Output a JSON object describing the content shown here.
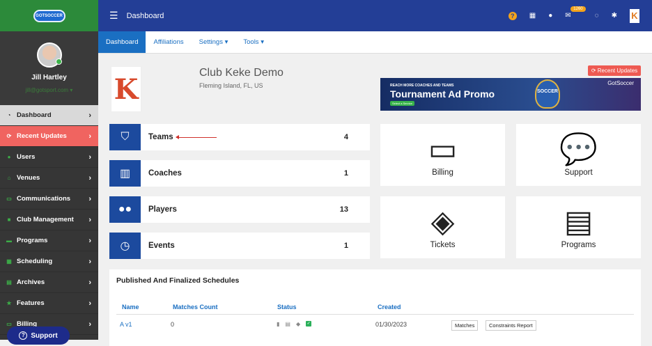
{
  "sidebar": {
    "logo_text": "GOTSOCCER",
    "user_name": "Jill Hartley",
    "user_email": "jill@gotsport.com",
    "items": [
      {
        "label": "Dashboard",
        "icon": "tachometer-icon"
      },
      {
        "label": "Recent Updates",
        "icon": "refresh-icon"
      },
      {
        "label": "Users",
        "icon": "users-icon"
      },
      {
        "label": "Venues",
        "icon": "home-icon"
      },
      {
        "label": "Communications",
        "icon": "chat-icon"
      },
      {
        "label": "Club Management",
        "icon": "briefcase-icon"
      },
      {
        "label": "Programs",
        "icon": "folder-icon"
      },
      {
        "label": "Scheduling",
        "icon": "calendar-icon"
      },
      {
        "label": "Archives",
        "icon": "archive-icon"
      },
      {
        "label": "Features",
        "icon": "star-icon"
      },
      {
        "label": "Billing",
        "icon": "credit-card-icon"
      }
    ],
    "support_label": "Support"
  },
  "topbar": {
    "title": "Dashboard",
    "mail_badge": "1260"
  },
  "tabs": [
    {
      "label": "Dashboard"
    },
    {
      "label": "Affiliations"
    },
    {
      "label": "Settings"
    },
    {
      "label": "Tools"
    }
  ],
  "club": {
    "name": "Club Keke Demo",
    "location": "Fleming Island, FL, US",
    "logo_letter": "K"
  },
  "recent_updates_button": "Recent Updates",
  "ad": {
    "line1": "REACH MORE COACHES AND TEAMS",
    "headline": "Tournament Ad Promo",
    "cta": "Select a Service",
    "badge": "SOCCER",
    "brand": "GotSoccer"
  },
  "stats": [
    {
      "label": "Teams",
      "count": "4"
    },
    {
      "label": "Coaches",
      "count": "1"
    },
    {
      "label": "Players",
      "count": "13"
    },
    {
      "label": "Events",
      "count": "1"
    }
  ],
  "cards": [
    {
      "label": "Billing"
    },
    {
      "label": "Support"
    },
    {
      "label": "Tickets"
    },
    {
      "label": "Programs"
    }
  ],
  "schedules": {
    "title": "Published And Finalized Schedules",
    "headers": [
      "Name",
      "Matches Count",
      "Status",
      "Created"
    ],
    "rows": [
      {
        "name": "A v1",
        "matches": "0",
        "created": "01/30/2023",
        "btn1": "Matches",
        "btn2": "Constraints Report"
      }
    ]
  }
}
